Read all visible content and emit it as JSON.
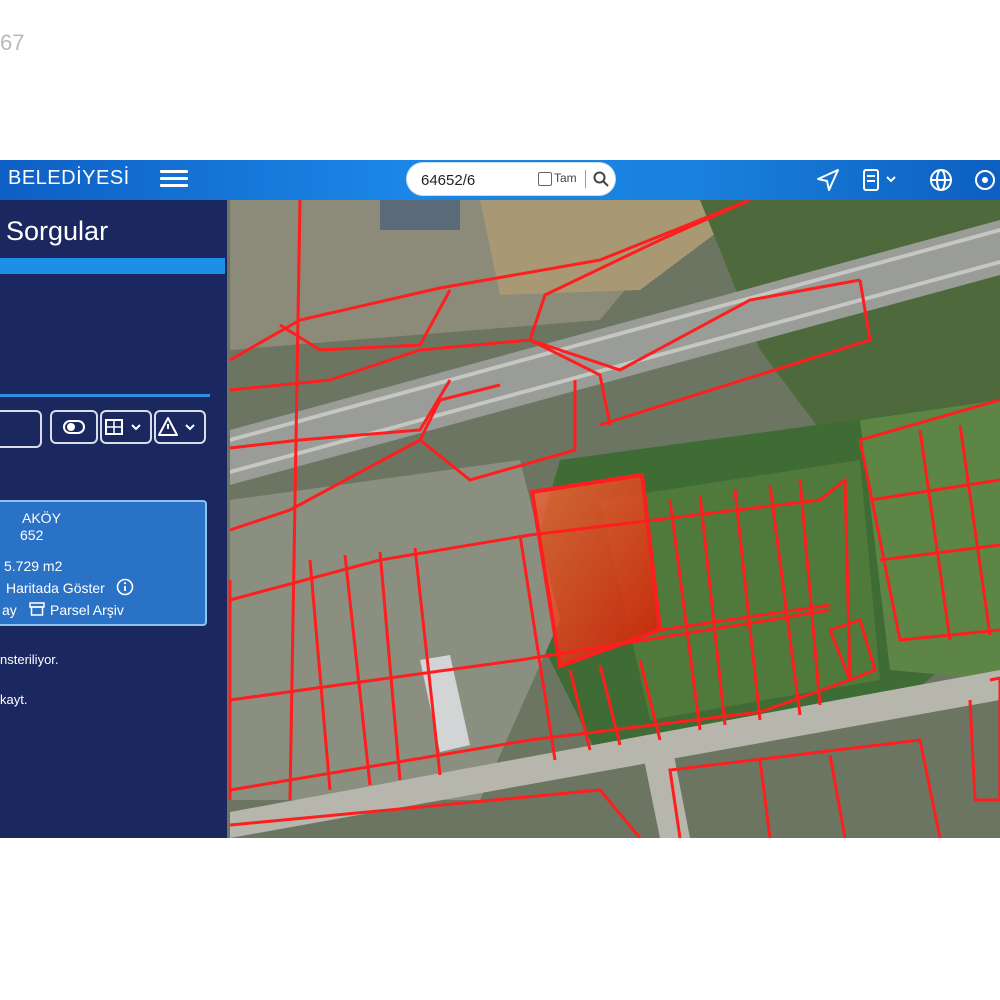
{
  "corner_number": "67",
  "header": {
    "brand": "BELEDİYESİ",
    "search_value": "64652/6",
    "tam_label": "Tam"
  },
  "icons": {
    "menu": "hamburger-icon",
    "search": "search-icon",
    "navigate": "navigation-arrow-icon",
    "layers": "layers-icon",
    "globe": "globe-icon",
    "location": "location-pin-icon"
  },
  "panel": {
    "title": "Sorgular",
    "result": {
      "village": "AKÖY",
      "parcel": "652",
      "area": "5.729 m2",
      "show_on_map": "Haritada Göster",
      "detail": "ay",
      "archive": "Parsel Arşiv"
    },
    "message1": "nsteriliyor.",
    "message2": "kayt."
  },
  "colors": {
    "accent": "#1e8fe8",
    "panel": "#0e1c60",
    "parcel_lines": "#ff1e1e",
    "selected_parcel": "#ff3a10"
  }
}
